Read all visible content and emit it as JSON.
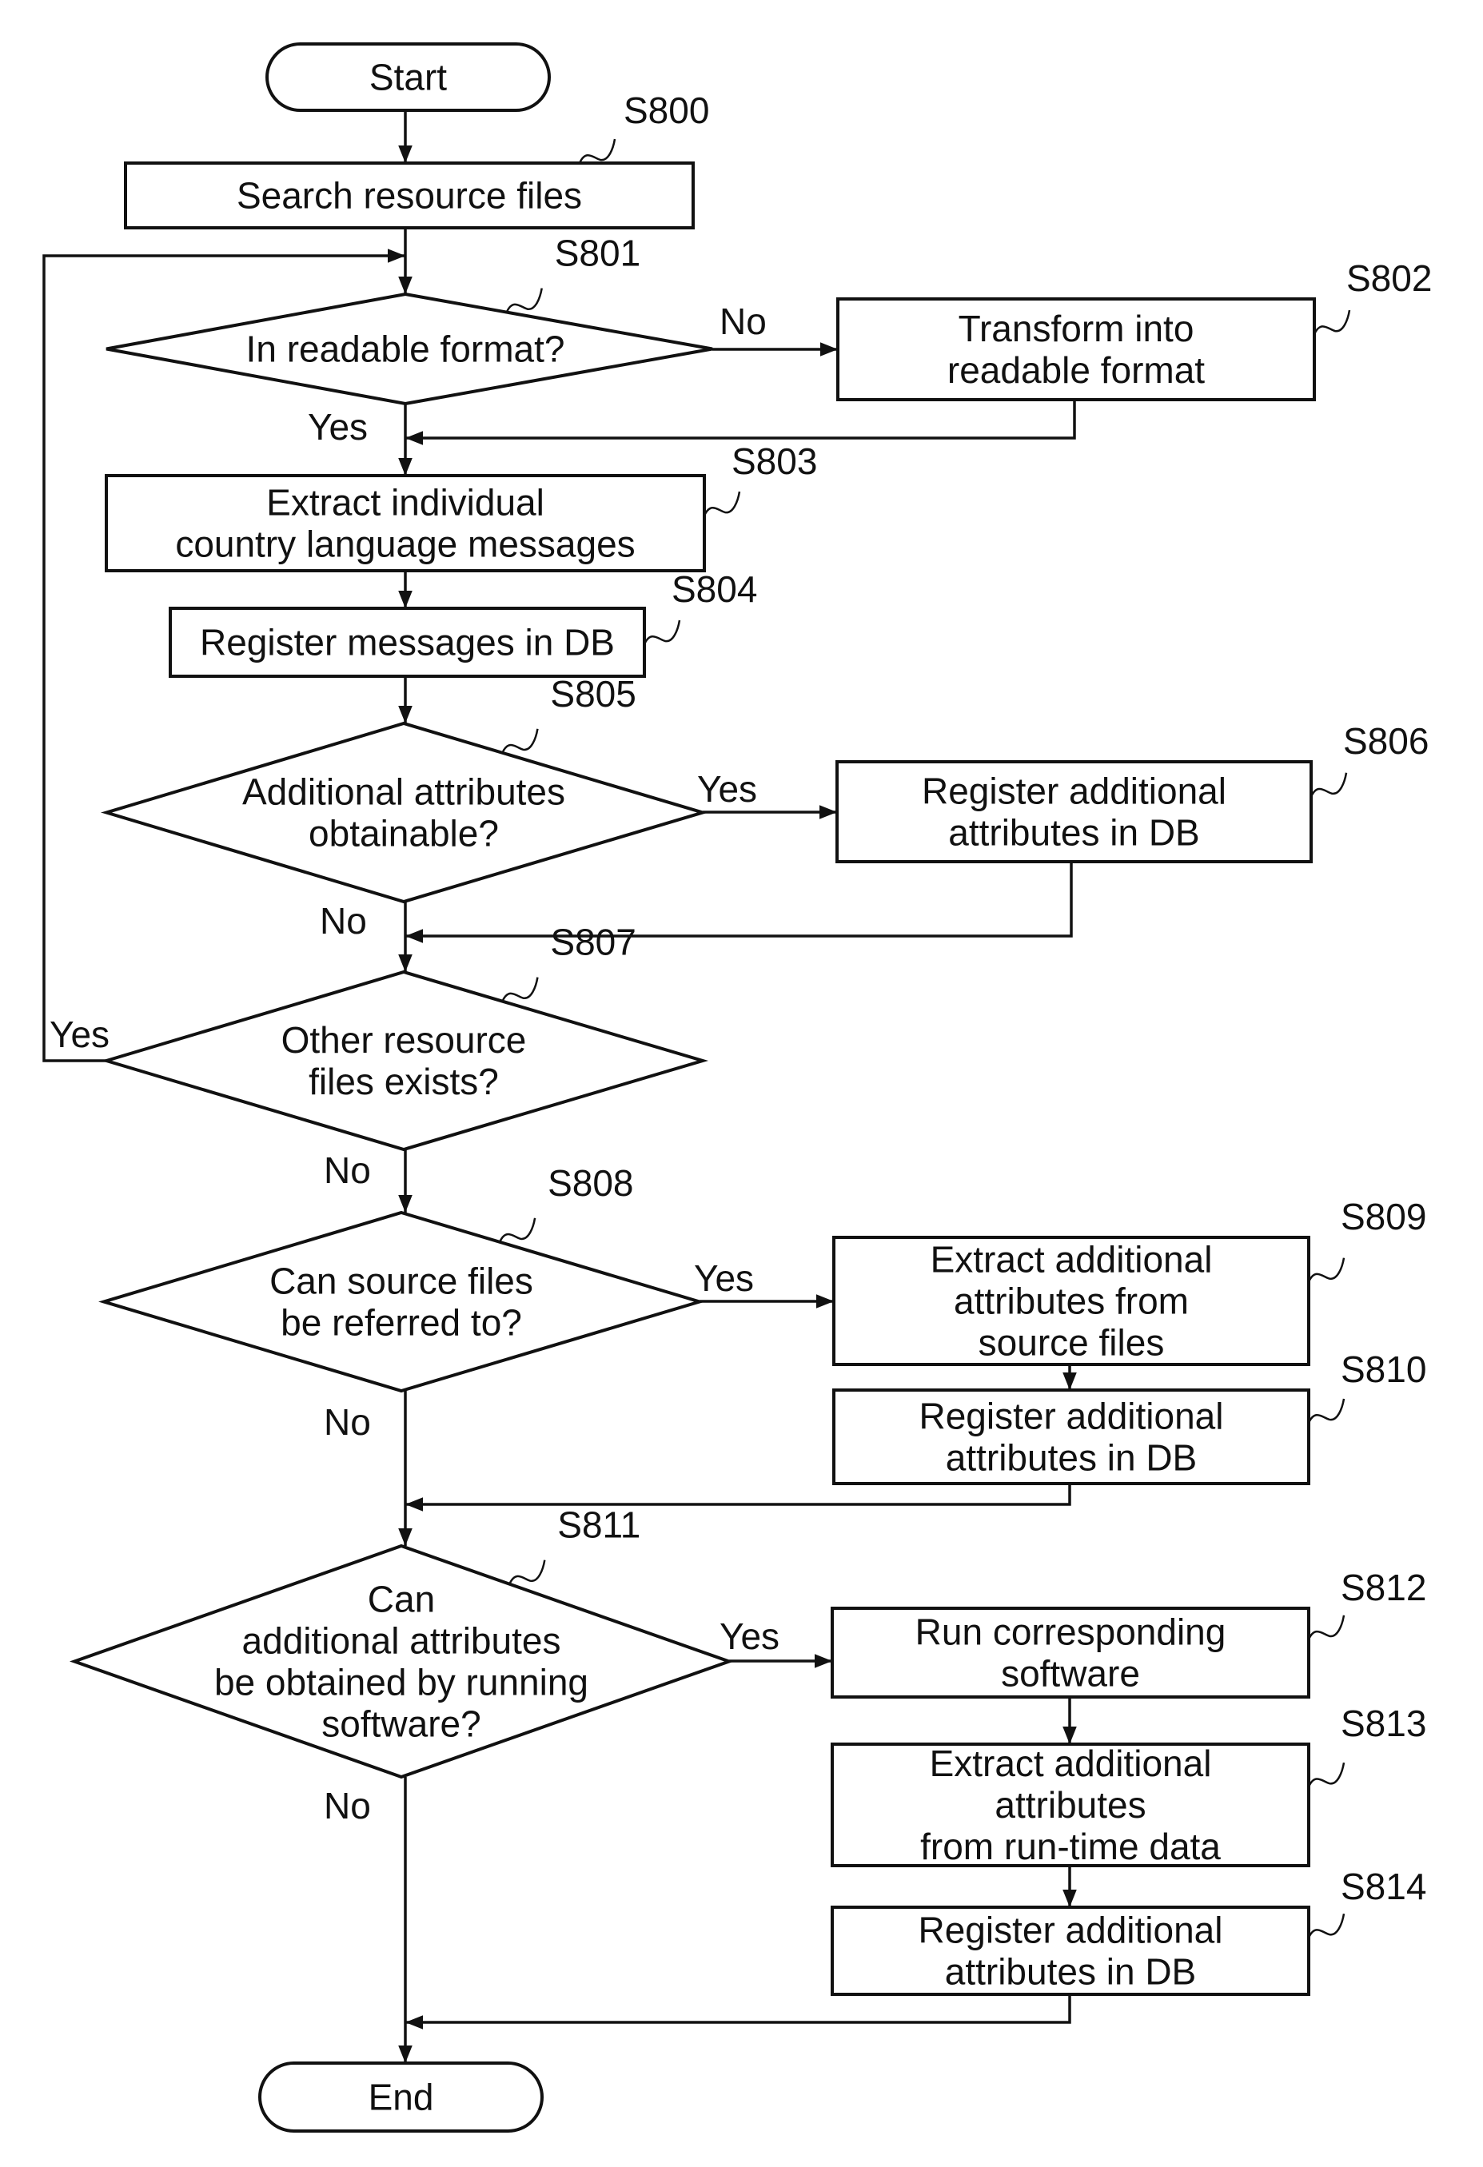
{
  "diagram": {
    "type": "flowchart",
    "nodes": [
      {
        "id": "start",
        "kind": "terminal",
        "lines": [
          "Start"
        ]
      },
      {
        "id": "S800",
        "kind": "process",
        "ref": "S800",
        "lines": [
          "Search resource files"
        ]
      },
      {
        "id": "S801",
        "kind": "decision",
        "ref": "S801",
        "lines": [
          "In readable format?"
        ]
      },
      {
        "id": "S802",
        "kind": "process",
        "ref": "S802",
        "lines": [
          "Transform into",
          "readable format"
        ]
      },
      {
        "id": "S803",
        "kind": "process",
        "ref": "S803",
        "lines": [
          "Extract individual",
          "country language messages"
        ]
      },
      {
        "id": "S804",
        "kind": "process",
        "ref": "S804",
        "lines": [
          "Register messages in DB"
        ]
      },
      {
        "id": "S805",
        "kind": "decision",
        "ref": "S805",
        "lines": [
          "Additional attributes",
          "obtainable?"
        ]
      },
      {
        "id": "S806",
        "kind": "process",
        "ref": "S806",
        "lines": [
          "Register additional",
          "attributes in DB"
        ]
      },
      {
        "id": "S807",
        "kind": "decision",
        "ref": "S807",
        "lines": [
          "Other resource",
          "files exists?"
        ]
      },
      {
        "id": "S808",
        "kind": "decision",
        "ref": "S808",
        "lines": [
          "Can source files",
          "be referred to?"
        ]
      },
      {
        "id": "S809",
        "kind": "process",
        "ref": "S809",
        "lines": [
          "Extract additional",
          "attributes from",
          "source files"
        ]
      },
      {
        "id": "S810",
        "kind": "process",
        "ref": "S810",
        "lines": [
          "Register additional",
          "attributes in DB"
        ]
      },
      {
        "id": "S811",
        "kind": "decision",
        "ref": "S811",
        "lines": [
          "Can",
          "additional attributes",
          "be obtained by running",
          "software?"
        ]
      },
      {
        "id": "S812",
        "kind": "process",
        "ref": "S812",
        "lines": [
          "Run corresponding",
          "software"
        ]
      },
      {
        "id": "S813",
        "kind": "process",
        "ref": "S813",
        "lines": [
          "Extract additional",
          "attributes",
          "from run-time data"
        ]
      },
      {
        "id": "S814",
        "kind": "process",
        "ref": "S814",
        "lines": [
          "Register additional",
          "attributes in DB"
        ]
      },
      {
        "id": "end",
        "kind": "terminal",
        "lines": [
          "End"
        ]
      }
    ],
    "edges": [
      {
        "from": "start",
        "to": "S800",
        "label": ""
      },
      {
        "from": "S800",
        "to": "S801",
        "label": ""
      },
      {
        "from": "S801",
        "to": "S802",
        "label": "No"
      },
      {
        "from": "S801",
        "to": "S803",
        "label": "Yes"
      },
      {
        "from": "S802",
        "to": "S803",
        "label": ""
      },
      {
        "from": "S803",
        "to": "S804",
        "label": ""
      },
      {
        "from": "S804",
        "to": "S805",
        "label": ""
      },
      {
        "from": "S805",
        "to": "S806",
        "label": "Yes"
      },
      {
        "from": "S805",
        "to": "S807",
        "label": "No"
      },
      {
        "from": "S806",
        "to": "S807",
        "label": ""
      },
      {
        "from": "S807",
        "to": "S801",
        "label": "Yes"
      },
      {
        "from": "S807",
        "to": "S808",
        "label": "No"
      },
      {
        "from": "S808",
        "to": "S809",
        "label": "Yes"
      },
      {
        "from": "S808",
        "to": "S811",
        "label": "No"
      },
      {
        "from": "S809",
        "to": "S810",
        "label": ""
      },
      {
        "from": "S810",
        "to": "S811",
        "label": ""
      },
      {
        "from": "S811",
        "to": "S812",
        "label": "Yes"
      },
      {
        "from": "S811",
        "to": "end",
        "label": "No"
      },
      {
        "from": "S812",
        "to": "S813",
        "label": ""
      },
      {
        "from": "S813",
        "to": "S814",
        "label": ""
      },
      {
        "from": "S814",
        "to": "end",
        "label": ""
      }
    ]
  }
}
